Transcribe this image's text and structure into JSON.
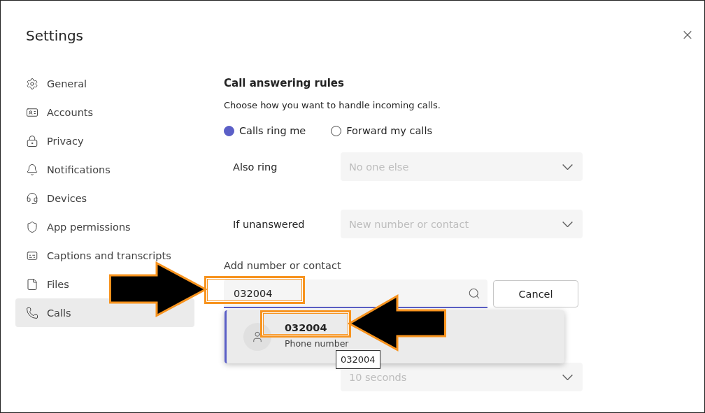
{
  "window": {
    "title": "Settings"
  },
  "sidebar": {
    "items": [
      {
        "label": "General",
        "selected": false
      },
      {
        "label": "Accounts",
        "selected": false
      },
      {
        "label": "Privacy",
        "selected": false
      },
      {
        "label": "Notifications",
        "selected": false
      },
      {
        "label": "Devices",
        "selected": false
      },
      {
        "label": "App permissions",
        "selected": false
      },
      {
        "label": "Captions and transcripts",
        "selected": false
      },
      {
        "label": "Files",
        "selected": false
      },
      {
        "label": "Calls",
        "selected": true
      }
    ]
  },
  "call_answering": {
    "title": "Call answering rules",
    "description": "Choose how you want to handle incoming calls.",
    "options": [
      {
        "label": "Calls ring me",
        "selected": true
      },
      {
        "label": "Forward my calls",
        "selected": false
      }
    ],
    "rules": [
      {
        "label": "Also ring",
        "value": "No one else",
        "disabled": true
      },
      {
        "label": "If unanswered",
        "value": "New number or contact",
        "disabled": true
      }
    ],
    "add_contact": {
      "label": "Add number or contact",
      "value": "032004",
      "cancel": "Cancel"
    },
    "ring_duration": {
      "value": "10 seconds",
      "disabled": true
    }
  },
  "suggestion": {
    "name": "032004",
    "detail": "Phone number"
  },
  "tooltip": "032004"
}
